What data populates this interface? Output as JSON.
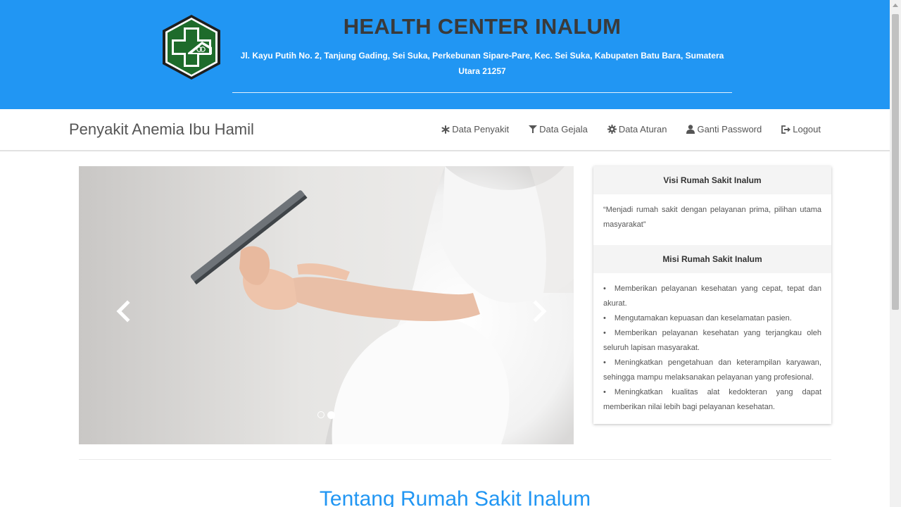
{
  "header": {
    "title": "HEALTH CENTER INALUM",
    "address": "Jl. Kayu Putih No. 2, Tanjung Gading, Sei Suka, Perkebunan Sipare-Pare, Kec. Sei Suka, Kabupaten Batu Bara, Sumatera Utara 21257",
    "logo_icon": "hospital-cross-logo"
  },
  "navbar": {
    "brand": "Penyakit Anemia Ibu Hamil",
    "links": [
      {
        "label": "Data Penyakit",
        "icon": "asterisk-icon"
      },
      {
        "label": "Data Gejala",
        "icon": "filter-icon"
      },
      {
        "label": "Data Aturan",
        "icon": "gear-icon"
      },
      {
        "label": "Ganti Password",
        "icon": "user-icon"
      },
      {
        "label": "Logout",
        "icon": "logout-icon"
      }
    ]
  },
  "carousel": {
    "image": "pregnant-woman-tablet",
    "slides": 2,
    "active_slide": 2
  },
  "card": {
    "visi_title": "Visi Rumah Sakit Inalum",
    "visi_text": "“Menjadi rumah sakit dengan pelayanan prima, pilihan utama masyarakat”",
    "misi_title": "Misi Rumah Sakit Inalum",
    "misi_items": [
      "Memberikan pelayanan kesehatan yang cepat, tepat dan akurat.",
      "Mengutamakan kepuasan dan keselamatan pasien.",
      "Memberikan pelayanan kesehatan yang terjangkau oleh seluruh lapisan masyarakat.",
      "Meningkatkan pengetahuan dan keterampilan karyawan, sehingga mampu melaksanakan pelayanan yang profesional.",
      "Meningkatkan kualitas alat kedokteran yang dapat memberikan nilai lebih bagi pelayanan kesehatan."
    ]
  },
  "section": {
    "title": "Tentang Rumah Sakit Inalum"
  },
  "colors": {
    "header_bg": "#2196f3",
    "logo_green": "#1e6b2b",
    "title_dark": "#3a3a3a"
  }
}
